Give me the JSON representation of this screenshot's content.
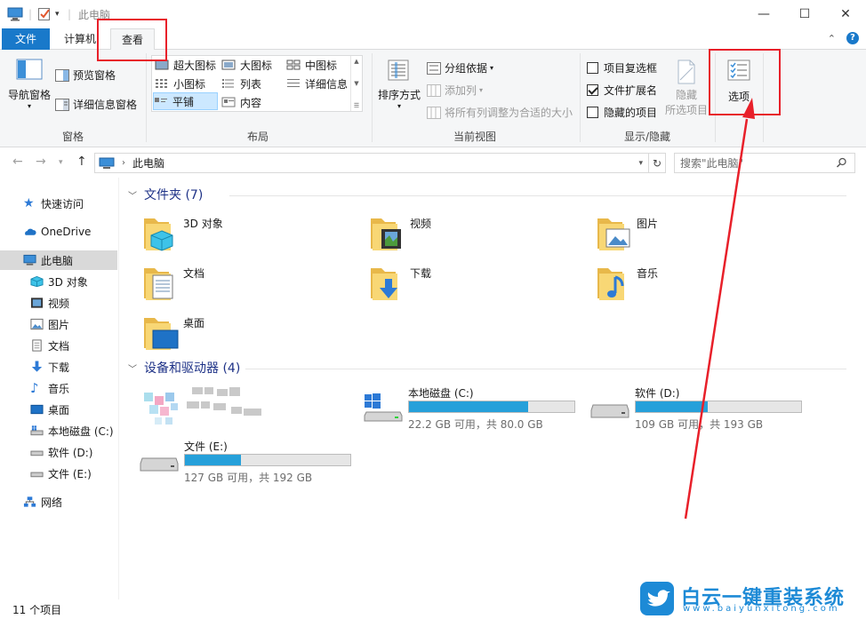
{
  "window": {
    "title": "此电脑",
    "minimize": "—",
    "maximize": "☐",
    "close": "✕"
  },
  "tabs": {
    "file": "文件",
    "computer": "计算机",
    "view": "查看"
  },
  "ribbon": {
    "panes": {
      "nav_pane": "导航窗格",
      "preview_pane": "预览窗格",
      "details_pane": "详细信息窗格",
      "group": "窗格"
    },
    "layout": {
      "extra_large": "超大图标",
      "large": "大图标",
      "medium": "中图标",
      "small": "小图标",
      "list": "列表",
      "details": "详细信息",
      "tiles": "平铺",
      "content": "内容",
      "group": "布局"
    },
    "current_view": {
      "sort_by": "排序方式",
      "group_by": "分组依据",
      "add_columns": "添加列",
      "size_all_columns": "将所有列调整为合适的大小",
      "group": "当前视图"
    },
    "show_hide": {
      "item_checkboxes": "项目复选框",
      "file_extensions": "文件扩展名",
      "hidden_items": "隐藏的项目",
      "hide_line1": "隐藏",
      "hide_line2": "所选项目",
      "group": "显示/隐藏"
    },
    "options": "选项"
  },
  "address": {
    "path": "此电脑",
    "search_placeholder": "搜索\"此电脑\""
  },
  "nav": {
    "quick_access": "快速访问",
    "onedrive": "OneDrive",
    "this_pc": "此电脑",
    "objects3d": "3D 对象",
    "videos": "视频",
    "pictures": "图片",
    "documents": "文档",
    "downloads": "下载",
    "music": "音乐",
    "desktop": "桌面",
    "drive_c": "本地磁盘 (C:)",
    "drive_d": "软件 (D:)",
    "drive_e": "文件 (E:)",
    "network": "网络"
  },
  "content": {
    "folders_header": "文件夹 (7)",
    "devices_header": "设备和驱动器 (4)",
    "folders": [
      "3D 对象",
      "视频",
      "图片",
      "文档",
      "下载",
      "音乐",
      "桌面"
    ],
    "drives": [
      {
        "name": "本地磁盘 (C:)",
        "info": "22.2 GB 可用，共 80.0 GB",
        "used": 0.7225
      },
      {
        "name": "软件 (D:)",
        "info": "109 GB 可用，共 193 GB",
        "used": 0.4352
      },
      {
        "name": "文件 (E:)",
        "info": "127 GB 可用，共 192 GB",
        "used": 0.3385
      }
    ]
  },
  "status": {
    "count": "11 个项目"
  },
  "colors": {
    "accent": "#1979ca",
    "drive_fill": "#26a0da",
    "annotation": "#e8202a",
    "watermark": "#1d8ad6"
  },
  "watermark": {
    "text": "白云一键重装系统",
    "url": "www.baiyunxitong.com"
  }
}
